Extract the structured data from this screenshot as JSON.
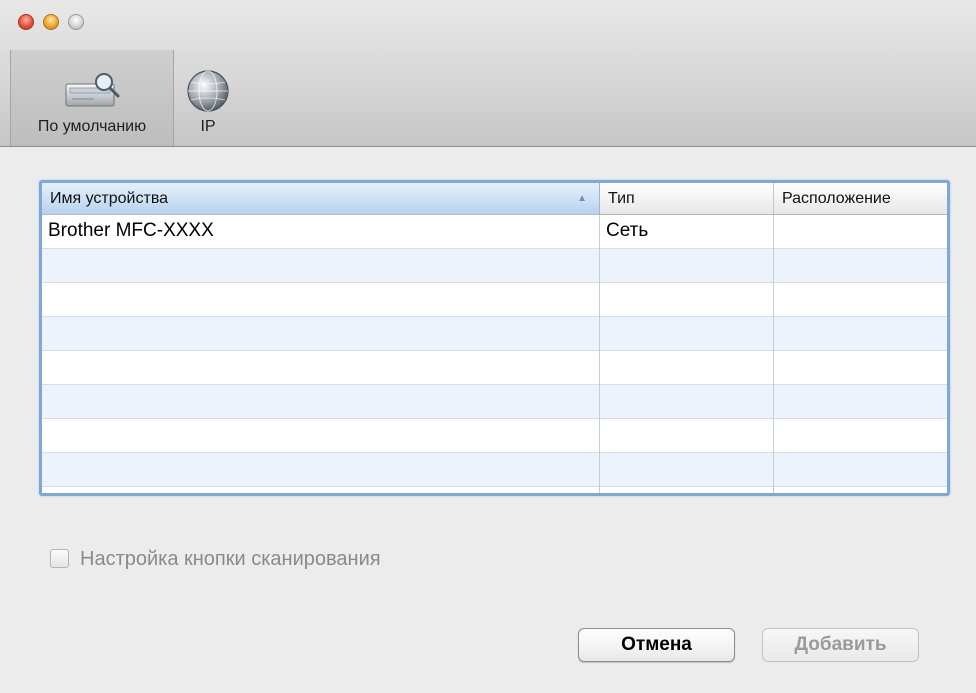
{
  "toolbar": {
    "items": [
      {
        "label": "По умолчанию",
        "icon": "default-scanner-icon",
        "selected": true
      },
      {
        "label": "IP",
        "icon": "globe-icon",
        "selected": false
      }
    ]
  },
  "device_table": {
    "columns": [
      "Имя устройства",
      "Тип",
      "Расположение"
    ],
    "sorted_column": "Имя устройства",
    "sort_direction": "ascending",
    "rows": [
      {
        "name": "Brother MFC-XXXX",
        "type": "Сеть",
        "location": ""
      }
    ]
  },
  "scan_button_checkbox": {
    "label": "Настройка кнопки сканирования",
    "checked": false,
    "enabled": false
  },
  "buttons": {
    "cancel": "Отмена",
    "add": "Добавить",
    "add_enabled": false
  }
}
